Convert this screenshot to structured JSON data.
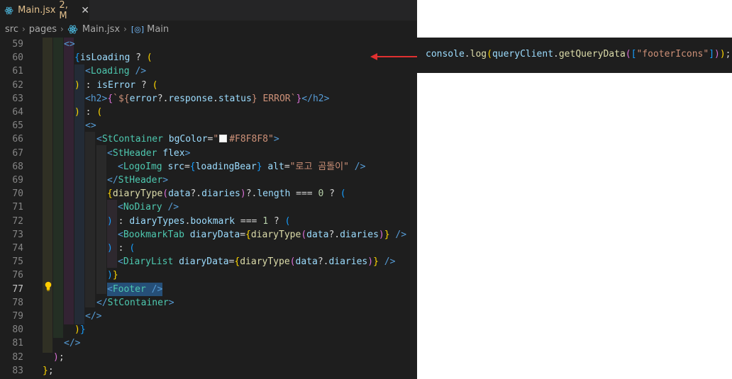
{
  "tab": {
    "file_name": "Main.jsx",
    "status": "2, M",
    "close": "✕"
  },
  "breadcrumb": {
    "items": [
      "src",
      "pages",
      "Main.jsx",
      "Main"
    ],
    "separator": "›"
  },
  "editor": {
    "current_line": 77,
    "lines": [
      {
        "n": 59
      },
      {
        "n": 60
      },
      {
        "n": 61
      },
      {
        "n": 62
      },
      {
        "n": 63
      },
      {
        "n": 64
      },
      {
        "n": 65
      },
      {
        "n": 66
      },
      {
        "n": 67
      },
      {
        "n": 68
      },
      {
        "n": 69
      },
      {
        "n": 70
      },
      {
        "n": 71
      },
      {
        "n": 72
      },
      {
        "n": 73
      },
      {
        "n": 74
      },
      {
        "n": 75
      },
      {
        "n": 76
      },
      {
        "n": 77
      },
      {
        "n": 78
      },
      {
        "n": 79
      },
      {
        "n": 80
      },
      {
        "n": 81
      },
      {
        "n": 82
      },
      {
        "n": 83
      }
    ]
  },
  "code": {
    "l60": {
      "a": "{",
      "b": "isLoading",
      "c": " ? ",
      "d": "("
    },
    "l61": {
      "a": "<",
      "b": "Loading",
      "c": " />"
    },
    "l62": {
      "a": ")",
      "b": " : ",
      "c": "isError",
      "d": " ? ",
      "e": "("
    },
    "l63": {
      "a": "<",
      "b": "h2",
      "c": ">",
      "d": "{",
      "e": "`${",
      "f": "error",
      "g": "?.",
      "h": "response",
      "i": ".",
      "j": "status",
      "k": "}",
      "l": " ERROR`",
      "m": "}",
      "n": "</",
      "o": "h2",
      "p": ">"
    },
    "l64": {
      "a": ")",
      "b": " : ",
      "c": "("
    },
    "l65": {
      "a": "<>"
    },
    "l66": {
      "a": "<",
      "b": "StContainer",
      "c": " bgColor",
      "d": "=",
      "e": "\"",
      "f": "#F8F8F8",
      "g": "\"",
      "h": ">",
      "swatch": "#F8F8F8"
    },
    "l67": {
      "a": "<",
      "b": "StHeader",
      "c": " flex",
      "d": ">"
    },
    "l68": {
      "a": "<",
      "b": "LogoImg",
      "c": " src",
      "d": "=",
      "e": "{",
      "f": "loadingBear",
      "g": "}",
      "h": " alt",
      "i": "=",
      "j": "\"로고 곰돌이\"",
      "k": " />"
    },
    "l69": {
      "a": "</",
      "b": "StHeader",
      "c": ">"
    },
    "l70": {
      "a": "{",
      "b": "diaryType",
      "c": "(",
      "d": "data",
      "e": "?.",
      "f": "diaries",
      "g": ")",
      "h": "?.",
      "i": "length",
      "j": " === ",
      "k": "0",
      "l": " ? ",
      "m": "("
    },
    "l71": {
      "a": "<",
      "b": "NoDiary",
      "c": " />"
    },
    "l72": {
      "a": ")",
      "b": " : ",
      "c": "diaryTypes",
      "d": ".",
      "e": "bookmark",
      "f": " === ",
      "g": "1",
      "h": " ? ",
      "i": "("
    },
    "l73": {
      "a": "<",
      "b": "BookmarkTab",
      "c": " diaryData",
      "d": "=",
      "e": "{",
      "f": "diaryType",
      "g": "(",
      "h": "data",
      "i": "?.",
      "j": "diaries",
      "k": ")",
      "l": "}",
      "m": " />"
    },
    "l74": {
      "a": ")",
      "b": " : ",
      "c": "("
    },
    "l75": {
      "a": "<",
      "b": "DiaryList",
      "c": " diaryData",
      "d": "=",
      "e": "{",
      "f": "diaryType",
      "g": "(",
      "h": "data",
      "i": "?.",
      "j": "diaries",
      "k": ")",
      "l": "}",
      "m": " />"
    },
    "l76": {
      "a": ")",
      "b": "}"
    },
    "l77": {
      "a": "<",
      "b": "Footer",
      "c": " />"
    },
    "l78": {
      "a": "</",
      "b": "StContainer",
      "c": ">"
    },
    "l79": {
      "a": "</>"
    },
    "l80": {
      "a": ")",
      "b": "}"
    },
    "l81": {
      "a": "</>"
    },
    "l82": {
      "a": ")",
      "b": ";"
    },
    "l83": {
      "a": "}",
      "b": ";"
    },
    "l59": {
      "a": "<>"
    }
  },
  "console": {
    "a": "console",
    "b": ".",
    "c": "log",
    "d": "(",
    "e": "queryClient",
    "f": ".",
    "g": "getQueryData",
    "h": "(",
    "i": "[",
    "j": "\"footerIcons\"",
    "k": "]",
    "l": ")",
    "m": ")",
    "n": ";"
  },
  "colors": {
    "arrow": "#e03030",
    "editor_bg": "#1e1e1e",
    "selection": "#264f78",
    "modified": "#e2c08d"
  },
  "icons": {
    "tab": "react-icon",
    "breadcrumb_file": "react-icon",
    "breadcrumb_symbol": "symbol-variable-icon",
    "gutter": "lightbulb-icon"
  }
}
